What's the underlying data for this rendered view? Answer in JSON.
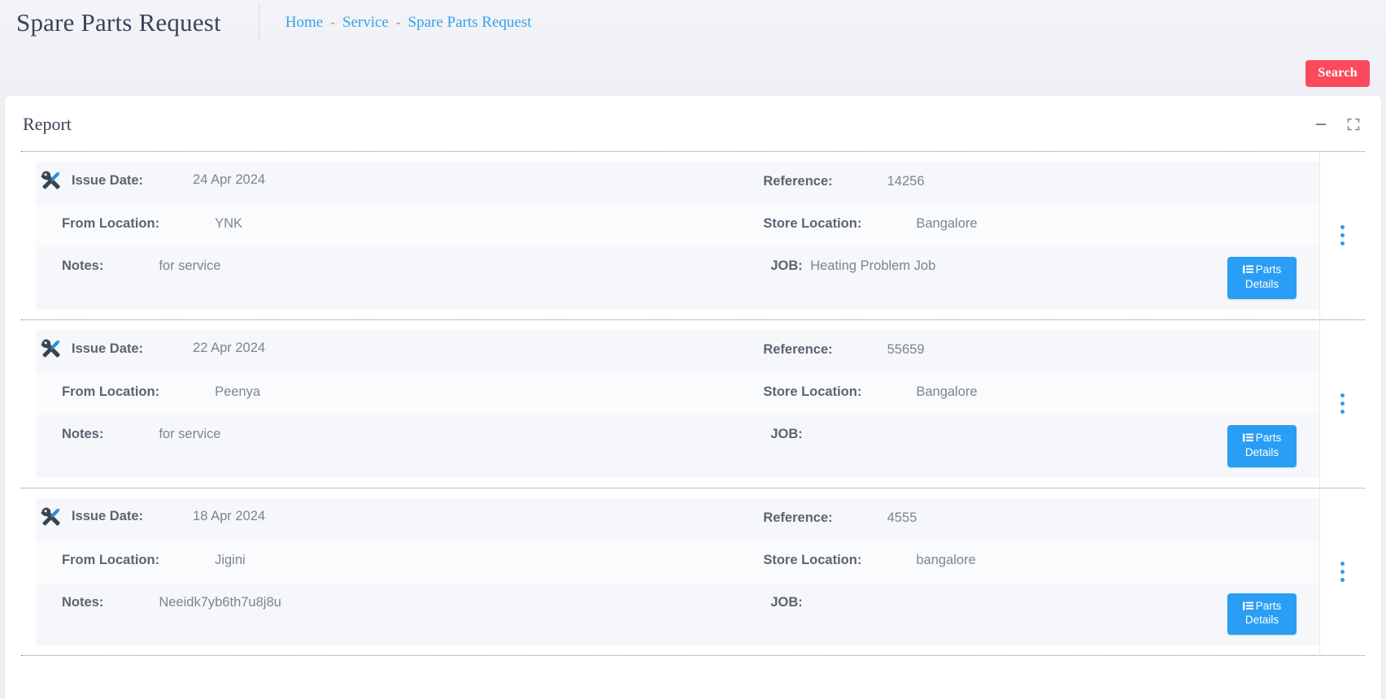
{
  "header": {
    "title": "Spare Parts Request",
    "breadcrumb": [
      {
        "label": "Home"
      },
      {
        "label": "Service"
      },
      {
        "label": "Spare Parts Request"
      }
    ],
    "breadcrumb_separator": "-",
    "search_button": "Search",
    "accent_red": "#fb4a5e",
    "accent_blue": "#2a9df4",
    "link_blue": "#38a1e8"
  },
  "card": {
    "title": "Report",
    "minimize_icon": "minus-icon",
    "expand_icon": "expand-icon"
  },
  "labels": {
    "issue_date": "Issue Date:",
    "reference": "Reference:",
    "from_location": "From Location:",
    "store_location": "Store Location:",
    "notes": "Notes:",
    "job": "JOB:",
    "parts_details": "Parts\nDetails",
    "parts_details_line1": "Parts",
    "parts_details_line2": "Details"
  },
  "records": [
    {
      "issue_date": "24 Apr 2024",
      "reference": "14256",
      "from_location": "YNK",
      "store_location": "Bangalore",
      "notes": "for service",
      "job": "Heating Problem Job"
    },
    {
      "issue_date": "22 Apr 2024",
      "reference": "55659",
      "from_location": "Peenya",
      "store_location": "Bangalore",
      "notes": "for service",
      "job": ""
    },
    {
      "issue_date": "18 Apr 2024",
      "reference": "4555",
      "from_location": "Jigini",
      "store_location": "bangalore",
      "notes": "Neeidk7yb6th7u8j8u",
      "job": ""
    }
  ]
}
